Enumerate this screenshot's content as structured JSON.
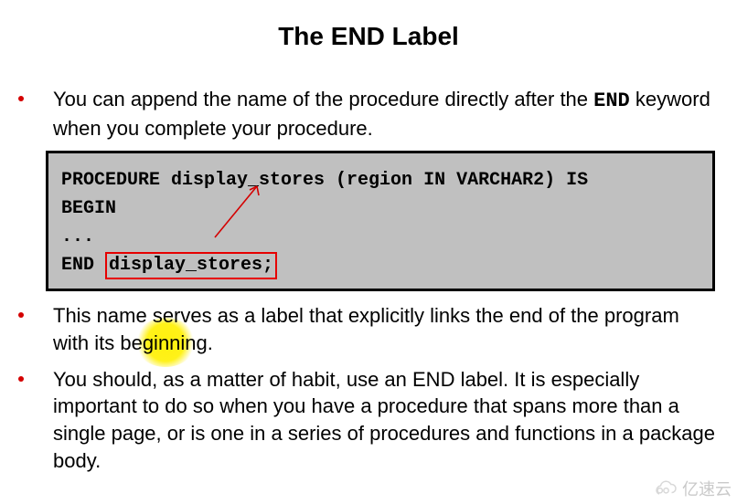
{
  "title": "The END Label",
  "bullets": {
    "b1_pre": "You can append the name of the procedure directly after the ",
    "b1_kw": "END",
    "b1_post": " keyword when you complete your procedure.",
    "b2": "This name serves as a label that explicitly links the end of the program with its beginning.",
    "b3": "You should, as a matter of habit, use an END label. It is especially important to do so when you have a procedure that spans more than a single page, or is one in a series of procedures and functions in a package body."
  },
  "code": {
    "line1": "PROCEDURE display_stores (region IN VARCHAR2) IS",
    "line2": "BEGIN",
    "line3": "...",
    "end_kw": "END ",
    "end_label": "display_stores;"
  },
  "watermark": "亿速云"
}
